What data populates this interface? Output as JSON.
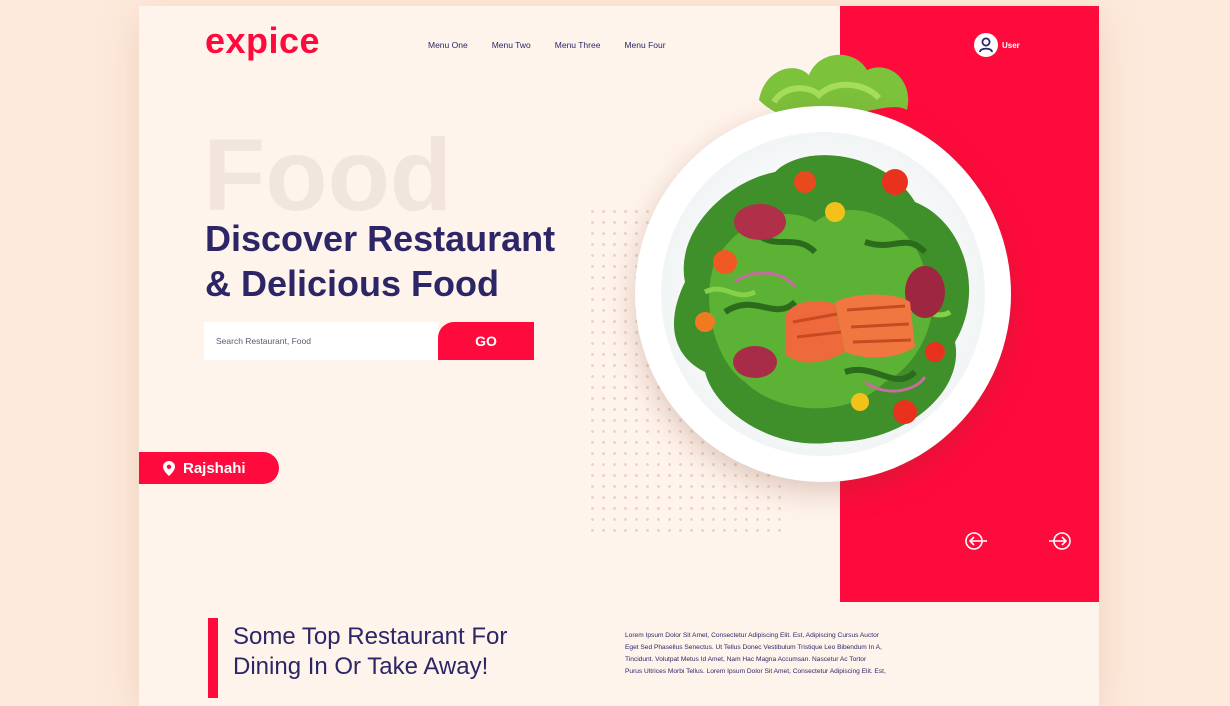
{
  "theme": {
    "accent": "#ff0a3c",
    "navy": "#2c2667",
    "cream": "#fff4ec"
  },
  "header": {
    "logo": "expice",
    "nav": [
      "Menu One",
      "Menu Two",
      "Menu Three",
      "Menu Four"
    ],
    "user_label": "User"
  },
  "hero": {
    "background_word": "Food",
    "headline_line1": "Discover Restaurant",
    "headline_line2": "& Delicious Food",
    "search_placeholder": "Search Restaurant, Food",
    "search_button": "GO",
    "location": "Rajshahi",
    "image_subject": "salmon salad plate",
    "icons": [
      "user-icon",
      "location-pin-icon",
      "arrow-left-icon",
      "arrow-right-icon"
    ]
  },
  "section": {
    "title_line1": "Some Top Restaurant For",
    "title_line2": "Dining In Or Take Away!",
    "body_lines": [
      "Lorem Ipsum Dolor Sit Amet, Consectetur Adipiscing Elit. Est, Adipiscing Cursus Auctor",
      "Eget Sed Phasellus Senectus. Ut Tellus Donec Vestibulum Tristique Leo Bibendum In A,",
      "Tincidunt. Volutpat Metus Id Amet, Nam Hac Magna Accumsan. Nascetur Ac Tortor",
      "Purus Ultrices Morbi Tellus. Lorem Ipsum Dolor Sit Amet, Consectetur Adipiscing Elit. Est,"
    ]
  }
}
